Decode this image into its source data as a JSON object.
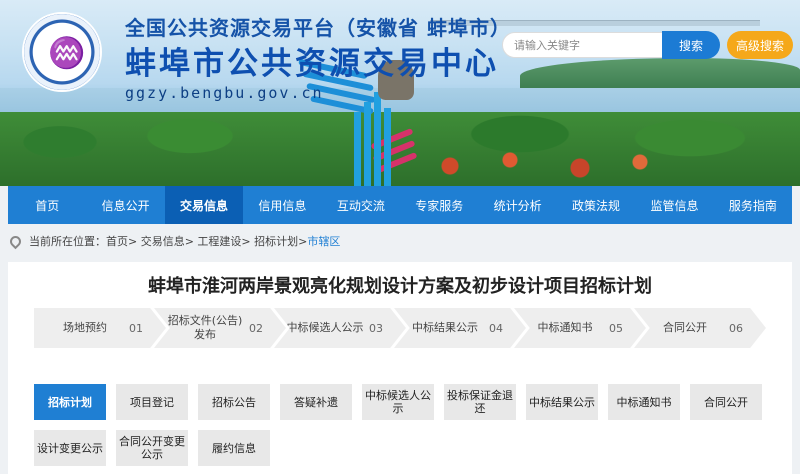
{
  "header": {
    "platform_name": "全国公共资源交易平台（安徽省 蚌埠市）",
    "center_name": "蚌埠市公共资源交易中心",
    "domain": "ggzy.bengbu.gov.cn"
  },
  "search": {
    "placeholder": "请输入关键字",
    "search_label": "搜索",
    "advanced_label": "高级搜索"
  },
  "nav": {
    "items": [
      "首页",
      "信息公开",
      "交易信息",
      "信用信息",
      "互动交流",
      "专家服务",
      "统计分析",
      "政策法规",
      "监管信息",
      "服务指南"
    ],
    "active_index": 2
  },
  "breadcrumb": {
    "prefix": "当前所在位置：",
    "path": "首页> 交易信息> 工程建设> 招标计划>",
    "current": "市辖区"
  },
  "page": {
    "title": "蚌埠市淮河两岸景观亮化规划设计方案及初步设计项目招标计划"
  },
  "steps": [
    {
      "label": "场地预约",
      "num": "01"
    },
    {
      "label": "招标文件(公告)发布",
      "num": "02"
    },
    {
      "label": "中标候选人公示",
      "num": "03"
    },
    {
      "label": "中标结果公示",
      "num": "04"
    },
    {
      "label": "中标通知书",
      "num": "05"
    },
    {
      "label": "合同公开",
      "num": "06"
    }
  ],
  "tabs": [
    {
      "label": "招标计划",
      "active": true
    },
    {
      "label": "项目登记",
      "active": false
    },
    {
      "label": "招标公告",
      "active": false
    },
    {
      "label": "答疑补遗",
      "active": false
    },
    {
      "label": "中标候选人公示",
      "active": false
    },
    {
      "label": "投标保证金退还",
      "active": false
    },
    {
      "label": "中标结果公示",
      "active": false
    },
    {
      "label": "中标通知书",
      "active": false
    },
    {
      "label": "合同公开",
      "active": false
    },
    {
      "label": "设计变更公示",
      "active": false
    },
    {
      "label": "合同公开变更公示",
      "active": false
    },
    {
      "label": "履约信息",
      "active": false
    }
  ],
  "colors": {
    "nav_blue": "#1f7fd3",
    "nav_active": "#0b5fb4",
    "advanced_orange": "#f5a81a",
    "title_blue": "#0e4fb0"
  }
}
